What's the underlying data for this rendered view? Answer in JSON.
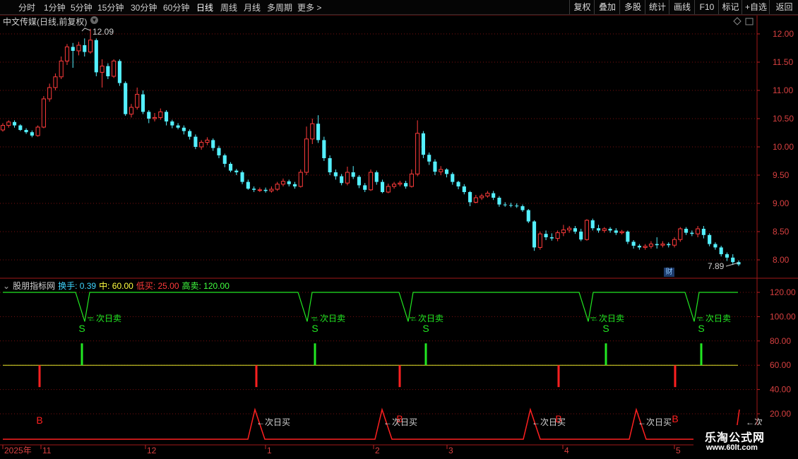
{
  "toolbar": {
    "periods": [
      "分时",
      "1分钟",
      "5分钟",
      "15分钟",
      "30分钟",
      "60分钟",
      "日线",
      "周线",
      "月线",
      "多周期",
      "更多 >"
    ],
    "active_period": "日线",
    "right_buttons": [
      "复权",
      "叠加",
      "多股",
      "统计",
      "画线",
      "F10",
      "标记",
      "+自选",
      "返回"
    ]
  },
  "stock": {
    "title": "中文传媒(日线,前复权)",
    "high_label": "12.09",
    "low_label": "7.89",
    "cai_badge": "财"
  },
  "price_axis": [
    "12.00",
    "11.50",
    "11.00",
    "10.50",
    "10.00",
    "9.50",
    "9.00",
    "8.50",
    "8.00"
  ],
  "indicator": {
    "name": "股朋指标网",
    "params": [
      {
        "label": "换手: 0.39",
        "color": "#3fd6ff"
      },
      {
        "label": "中: 60.00",
        "color": "#ffff40"
      },
      {
        "label": "低买: 25.00",
        "color": "#ff3a3a"
      },
      {
        "label": "高卖: 120.00",
        "color": "#40ff40"
      }
    ],
    "axis": [
      "120.00",
      "100.00",
      "80.00",
      "60.00",
      "40.00",
      "20.00"
    ],
    "sell_label": "S",
    "buy_label": "B",
    "next_sell": "←次日卖",
    "next_buy": "←次日买"
  },
  "date_axis": [
    "2025年",
    "11",
    "12",
    "1",
    "2",
    "3",
    "4",
    "5"
  ],
  "watermark": {
    "line1": "乐淘公式网",
    "line2": "www.60lt.com"
  },
  "colors": {
    "up": "#ff3b3b",
    "down": "#54f0ff",
    "grid": "#7a1010",
    "sell": "#22e822",
    "buy": "#ff2020",
    "mid": "#e6e62a"
  },
  "chart_data": {
    "type": "candlestick",
    "ylim": [
      7.8,
      12.3
    ],
    "candles": [
      [
        10.3,
        10.38,
        10.42,
        10.27
      ],
      [
        10.38,
        10.44,
        10.47,
        10.34
      ],
      [
        10.44,
        10.38,
        10.47,
        10.34
      ],
      [
        10.38,
        10.3,
        10.4,
        10.28
      ],
      [
        10.3,
        10.26,
        10.33,
        10.23
      ],
      [
        10.26,
        10.2,
        10.29,
        10.17
      ],
      [
        10.2,
        10.35,
        10.38,
        10.18
      ],
      [
        10.35,
        10.85,
        10.9,
        10.33
      ],
      [
        10.85,
        11.05,
        11.12,
        10.8
      ],
      [
        11.05,
        11.24,
        11.3,
        11.0
      ],
      [
        11.24,
        11.52,
        11.6,
        11.2
      ],
      [
        11.52,
        11.77,
        11.82,
        11.45
      ],
      [
        11.77,
        11.7,
        11.84,
        11.4
      ],
      [
        11.7,
        11.8,
        11.86,
        11.62
      ],
      [
        11.8,
        11.68,
        11.92,
        11.6
      ],
      [
        11.68,
        11.89,
        12.09,
        11.65
      ],
      [
        11.89,
        11.32,
        11.92,
        11.25
      ],
      [
        11.32,
        11.43,
        11.55,
        11.05
      ],
      [
        11.43,
        11.25,
        11.48,
        11.2
      ],
      [
        11.25,
        11.52,
        11.55,
        11.22
      ],
      [
        11.52,
        11.13,
        11.55,
        11.08
      ],
      [
        11.13,
        10.58,
        11.16,
        10.55
      ],
      [
        10.58,
        10.7,
        10.76,
        10.52
      ],
      [
        10.7,
        10.93,
        11.05,
        10.66
      ],
      [
        10.93,
        10.62,
        11.0,
        10.58
      ],
      [
        10.62,
        10.5,
        10.65,
        10.42
      ],
      [
        10.5,
        10.52,
        10.6,
        10.45
      ],
      [
        10.52,
        10.62,
        10.68,
        10.48
      ],
      [
        10.62,
        10.45,
        10.65,
        10.38
      ],
      [
        10.45,
        10.38,
        10.48,
        10.33
      ],
      [
        10.38,
        10.34,
        10.42,
        10.31
      ],
      [
        10.34,
        10.28,
        10.38,
        10.22
      ],
      [
        10.28,
        10.18,
        10.31,
        10.13
      ],
      [
        10.18,
        10.0,
        10.22,
        9.96
      ],
      [
        10.0,
        10.08,
        10.12,
        9.95
      ],
      [
        10.08,
        10.12,
        10.17,
        10.03
      ],
      [
        10.12,
        9.98,
        10.15,
        9.93
      ],
      [
        9.98,
        9.85,
        10.02,
        9.8
      ],
      [
        9.85,
        9.7,
        9.88,
        9.64
      ],
      [
        9.7,
        9.58,
        9.73,
        9.55
      ],
      [
        9.58,
        9.55,
        9.61,
        9.5
      ],
      [
        9.55,
        9.38,
        9.58,
        9.34
      ],
      [
        9.38,
        9.26,
        9.42,
        9.24
      ],
      [
        9.26,
        9.24,
        9.3,
        9.2
      ],
      [
        9.24,
        9.24,
        9.28,
        9.2
      ],
      [
        9.24,
        9.22,
        9.28,
        9.19
      ],
      [
        9.22,
        9.25,
        9.3,
        9.19
      ],
      [
        9.25,
        9.34,
        9.38,
        9.22
      ],
      [
        9.34,
        9.39,
        9.44,
        9.3
      ],
      [
        9.39,
        9.34,
        9.42,
        9.3
      ],
      [
        9.34,
        9.3,
        9.38,
        9.26
      ],
      [
        9.3,
        9.55,
        9.6,
        9.28
      ],
      [
        9.55,
        10.14,
        10.36,
        9.5
      ],
      [
        10.14,
        10.41,
        10.5,
        10.05
      ],
      [
        10.41,
        10.12,
        10.56,
        10.07
      ],
      [
        10.12,
        9.8,
        10.18,
        9.75
      ],
      [
        9.8,
        9.55,
        9.85,
        9.5
      ],
      [
        9.55,
        9.48,
        9.6,
        9.42
      ],
      [
        9.48,
        9.36,
        9.52,
        9.32
      ],
      [
        9.36,
        9.55,
        9.65,
        9.32
      ],
      [
        9.55,
        9.47,
        9.66,
        9.43
      ],
      [
        9.47,
        9.32,
        9.5,
        9.27
      ],
      [
        9.32,
        9.24,
        9.36,
        9.2
      ],
      [
        9.24,
        9.55,
        9.6,
        9.22
      ],
      [
        9.55,
        9.38,
        9.58,
        9.33
      ],
      [
        9.38,
        9.2,
        9.42,
        9.18
      ],
      [
        9.2,
        9.3,
        9.35,
        9.18
      ],
      [
        9.3,
        9.34,
        9.38,
        9.26
      ],
      [
        9.34,
        9.36,
        9.4,
        9.3
      ],
      [
        9.36,
        9.3,
        9.4,
        9.26
      ],
      [
        9.3,
        9.52,
        9.6,
        9.28
      ],
      [
        9.52,
        10.24,
        10.47,
        9.48
      ],
      [
        10.24,
        9.86,
        10.28,
        9.8
      ],
      [
        9.86,
        9.74,
        9.9,
        9.68
      ],
      [
        9.74,
        9.56,
        9.78,
        9.5
      ],
      [
        9.56,
        9.6,
        9.66,
        9.5
      ],
      [
        9.6,
        9.52,
        9.62,
        9.46
      ],
      [
        9.52,
        9.38,
        9.55,
        9.33
      ],
      [
        9.38,
        9.3,
        9.4,
        9.25
      ],
      [
        9.3,
        9.2,
        9.34,
        9.16
      ],
      [
        9.2,
        9.02,
        9.22,
        8.95
      ],
      [
        9.02,
        9.1,
        9.15,
        9.0
      ],
      [
        9.1,
        9.13,
        9.17,
        9.06
      ],
      [
        9.13,
        9.18,
        9.22,
        9.1
      ],
      [
        9.18,
        9.1,
        9.22,
        9.06
      ],
      [
        9.1,
        8.98,
        9.13,
        8.94
      ],
      [
        8.98,
        8.97,
        9.02,
        8.94
      ],
      [
        8.97,
        8.96,
        9.01,
        8.93
      ],
      [
        8.96,
        8.95,
        9.0,
        8.92
      ],
      [
        8.95,
        8.88,
        8.98,
        8.85
      ],
      [
        8.88,
        8.68,
        8.9,
        8.65
      ],
      [
        8.68,
        8.22,
        8.7,
        8.16
      ],
      [
        8.22,
        8.46,
        8.5,
        8.18
      ],
      [
        8.46,
        8.4,
        8.52,
        8.35
      ],
      [
        8.4,
        8.38,
        8.47,
        8.34
      ],
      [
        8.38,
        8.48,
        8.52,
        8.33
      ],
      [
        8.48,
        8.53,
        8.62,
        8.42
      ],
      [
        8.53,
        8.56,
        8.6,
        8.48
      ],
      [
        8.56,
        8.5,
        8.6,
        8.46
      ],
      [
        8.5,
        8.36,
        8.55,
        8.33
      ],
      [
        8.36,
        8.7,
        8.72,
        8.34
      ],
      [
        8.7,
        8.56,
        8.73,
        8.52
      ],
      [
        8.56,
        8.52,
        8.62,
        8.48
      ],
      [
        8.52,
        8.55,
        8.58,
        8.48
      ],
      [
        8.55,
        8.52,
        8.58,
        8.48
      ],
      [
        8.52,
        8.48,
        8.56,
        8.44
      ],
      [
        8.48,
        8.5,
        8.53,
        8.45
      ],
      [
        8.5,
        8.32,
        8.52,
        8.28
      ],
      [
        8.32,
        8.25,
        8.35,
        8.2
      ],
      [
        8.25,
        8.22,
        8.28,
        8.18
      ],
      [
        8.22,
        8.24,
        8.28,
        8.18
      ],
      [
        8.24,
        8.28,
        8.33,
        8.2
      ],
      [
        8.28,
        8.26,
        8.4,
        8.2
      ],
      [
        8.26,
        8.28,
        8.33,
        8.22
      ],
      [
        8.28,
        8.26,
        8.31,
        8.22
      ],
      [
        8.26,
        8.36,
        8.4,
        8.22
      ],
      [
        8.36,
        8.55,
        8.58,
        8.32
      ],
      [
        8.55,
        8.48,
        8.58,
        8.44
      ],
      [
        8.48,
        8.46,
        8.52,
        8.42
      ],
      [
        8.46,
        8.55,
        8.6,
        8.4
      ],
      [
        8.55,
        8.44,
        8.6,
        8.38
      ],
      [
        8.44,
        8.28,
        8.47,
        8.24
      ],
      [
        8.28,
        8.22,
        8.31,
        8.18
      ],
      [
        8.22,
        8.1,
        8.25,
        8.06
      ],
      [
        8.1,
        8.04,
        8.13,
        7.98
      ],
      [
        8.04,
        7.96,
        8.1,
        7.91
      ],
      [
        7.96,
        7.92,
        7.99,
        7.89
      ]
    ],
    "indicator": {
      "signal_days": {
        "sell": [
          28,
          112,
          153,
          217,
          252
        ],
        "buy": [
          13,
          90,
          142,
          198,
          240
        ],
        "sell_dip": [
          115,
          430,
          573,
          828,
          978
        ],
        "buy_peak": [
          363,
          543,
          753,
          903,
          1045
        ]
      }
    }
  }
}
